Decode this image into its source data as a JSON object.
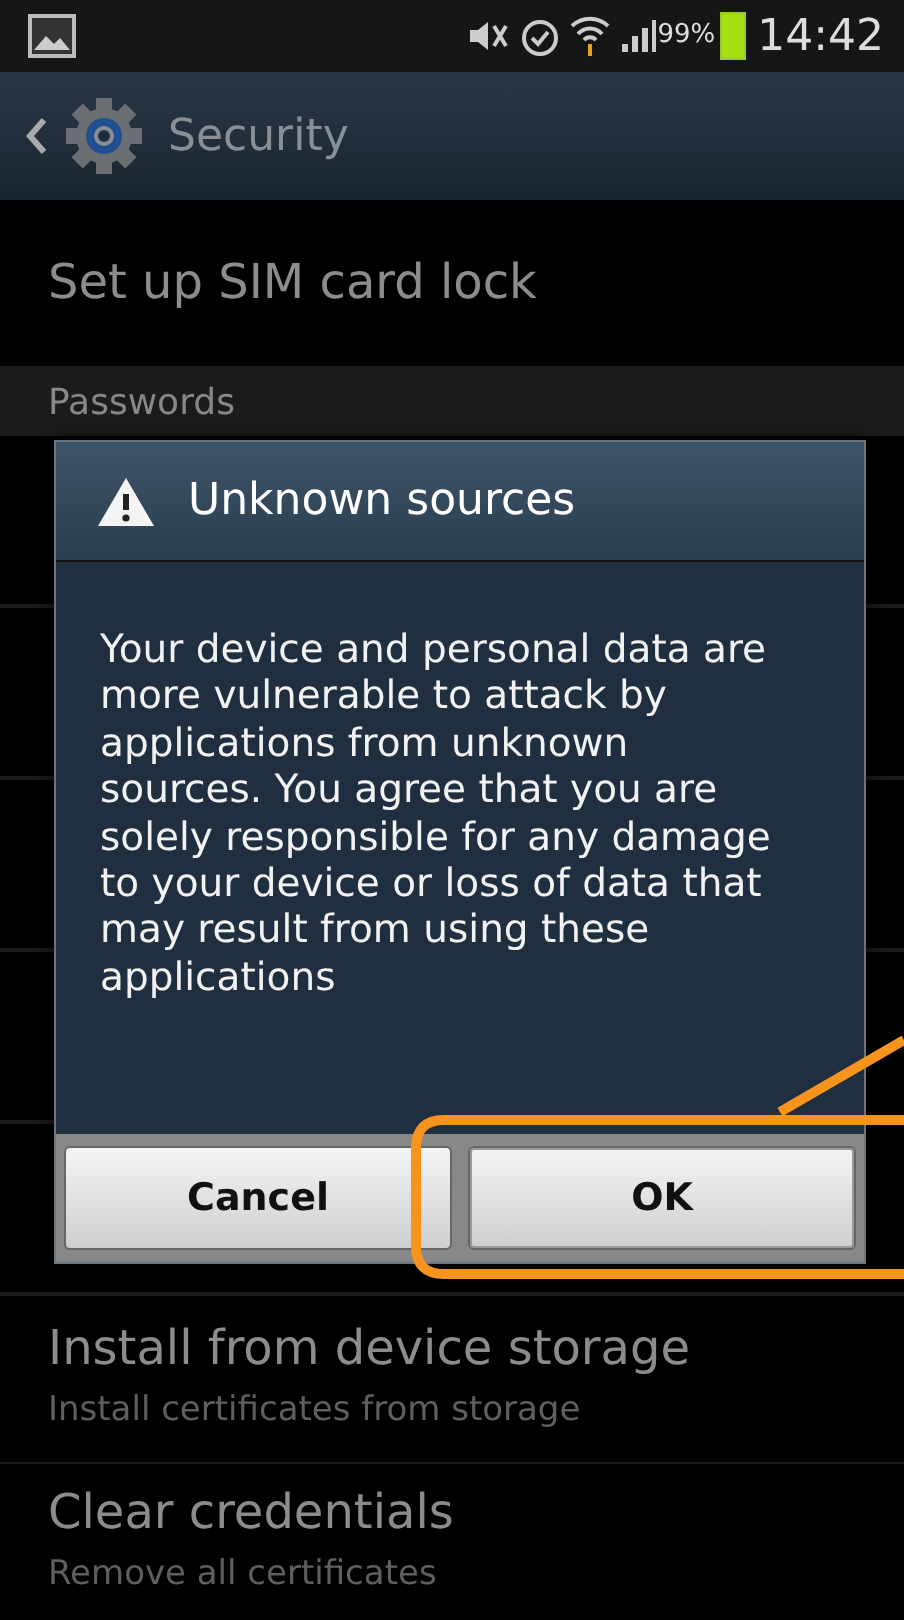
{
  "status_bar": {
    "battery_percent": "99%",
    "time": "14:42"
  },
  "action_bar": {
    "title": "Security"
  },
  "settings": [
    {
      "kind": "item",
      "title": "Set up SIM card lock"
    },
    {
      "kind": "header",
      "title": "Passwords"
    },
    {
      "kind": "hidden"
    },
    {
      "kind": "item",
      "title": "Install from device storage",
      "subtitle": "Install certificates from storage"
    },
    {
      "kind": "item",
      "title": "Clear credentials",
      "subtitle": "Remove all certificates"
    }
  ],
  "dialog": {
    "title": "Unknown sources",
    "message": "Your device and personal data are more vulnerable to attack by applications from unknown sources. You agree that you are solely responsible for any damage to your device or loss of data that may result from using these applications",
    "buttons": [
      {
        "label": "Cancel",
        "highlighted": false
      },
      {
        "label": "OK",
        "highlighted": true
      }
    ]
  }
}
